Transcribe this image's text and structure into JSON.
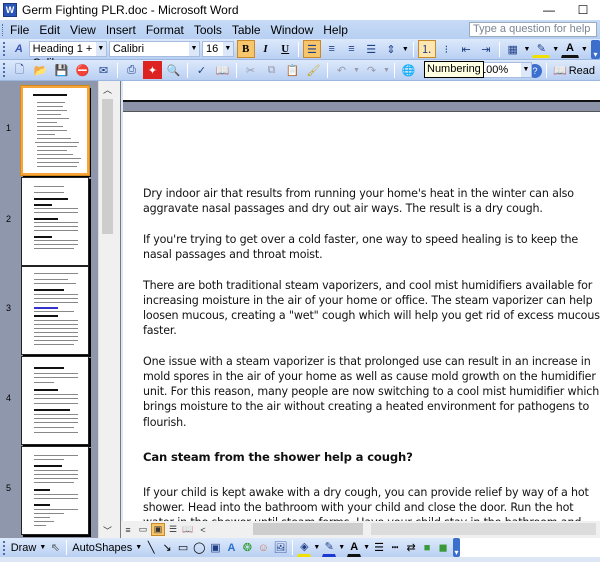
{
  "window": {
    "title": "Germ  Fighting PLR.doc - Microsoft Word",
    "minimize_symbol": "—",
    "maximize_symbol": "☐",
    "app_icon": "W"
  },
  "menubar": {
    "items": [
      {
        "label": "File"
      },
      {
        "label": "Edit"
      },
      {
        "label": "View"
      },
      {
        "label": "Insert"
      },
      {
        "label": "Format"
      },
      {
        "label": "Tools"
      },
      {
        "label": "Table"
      },
      {
        "label": "Window"
      },
      {
        "label": "Help"
      }
    ],
    "help_placeholder": "Type a question for help"
  },
  "formatting_toolbar": {
    "style": "Heading 1 + Calil",
    "font": "Calibri",
    "size": "16",
    "bold_label": "B",
    "italic_label": "I",
    "underline_label": "U",
    "bold_active": true,
    "align_left_active": true,
    "numbering_active": true
  },
  "standard_toolbar": {
    "tooltip": "Numbering",
    "zoom": "100%",
    "read_label": "Read"
  },
  "thumbnails": {
    "pages": [
      "1",
      "2",
      "3",
      "4",
      "5"
    ],
    "selected_page": "1"
  },
  "document": {
    "paragraphs": [
      "Dry indoor air that results from running your home's heat in the winter can also aggravate nasal passages and dry out air ways. The result is a dry cough.",
      "If you're trying to get over a cold faster, one way to speed healing is to keep the nasal passages and throat moist.",
      "There are both traditional steam vaporizers, and cool mist humidifiers available for increasing moisture in the air of your home or office. The steam vaporizer can help loosen mucous, creating a \"wet\" cough which will help you get rid of excess mucous faster.",
      "One issue with a steam vaporizer is that prolonged use can result in an increase in mold spores in the air of your home as well as cause mold growth on the humidifier unit. For this reason, many people are now switching to a cool mist humidifier which brings moisture to the air without creating a heated environment for pathogens to flourish."
    ],
    "heading": "Can steam from the shower help a cough?",
    "paragraph_after_heading": "If your child is kept awake with a dry cough, you can provide relief by way of a hot shower. Head into the bathroom with your child and close the door. Run the hot water in the shower until steam forms. Have your child stay in the bathroom and breathe in"
  },
  "drawing_toolbar": {
    "draw_label": "Draw",
    "autoshapes_label": "AutoShapes"
  },
  "colors": {
    "toolbar_bg": "#c7dbf6",
    "active_button": "#f8c66a",
    "thumb_pane_bg": "#8e97ac",
    "selected_thumb_border": "#f6a53a"
  }
}
